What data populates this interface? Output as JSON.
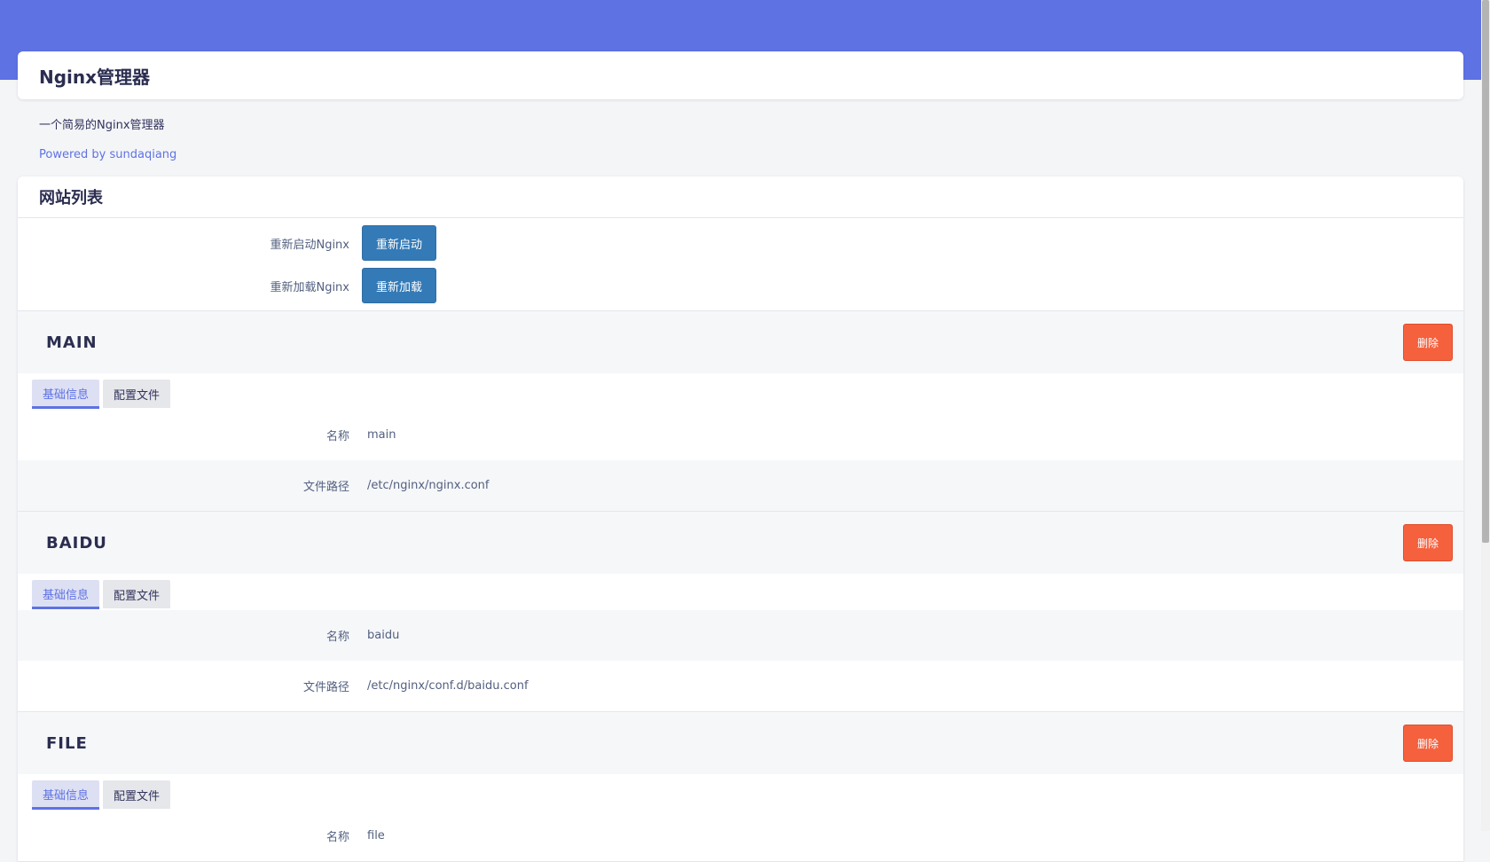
{
  "app": {
    "title": "Nginx管理器",
    "description": "一个简易的Nginx管理器",
    "powered_by": "Powered by sundaqiang"
  },
  "site_list": {
    "title": "网站列表",
    "controls": [
      {
        "label": "重新启动Nginx",
        "button": "重新启动"
      },
      {
        "label": "重新加载Nginx",
        "button": "重新加载"
      }
    ],
    "delete_label": "删除",
    "tabs": [
      "基础信息",
      "配置文件"
    ],
    "field_labels": {
      "name": "名称",
      "path": "文件路径"
    },
    "sites": [
      {
        "title": "MAIN",
        "name": "main",
        "path": "/etc/nginx/nginx.conf"
      },
      {
        "title": "BAIDU",
        "name": "baidu",
        "path": "/etc/nginx/conf.d/baidu.conf"
      },
      {
        "title": "FILE",
        "name": "file",
        "path": ""
      }
    ]
  },
  "colors": {
    "accent": "#5e72e4",
    "primary_button": "#337ab7",
    "danger_button": "#f5603d"
  }
}
